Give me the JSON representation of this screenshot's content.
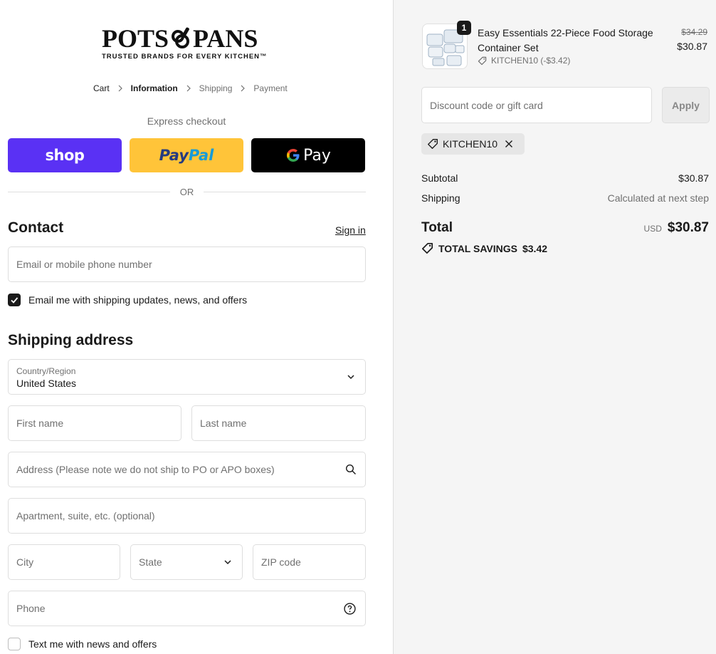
{
  "brand": {
    "logo_text_left": "POTS",
    "logo_text_right": "PANS",
    "tagline": "TRUSTED BRANDS FOR EVERY KITCHEN™"
  },
  "breadcrumb": {
    "items": [
      {
        "label": "Cart",
        "state": "link"
      },
      {
        "label": "Information",
        "state": "current"
      },
      {
        "label": "Shipping",
        "state": "upcoming"
      },
      {
        "label": "Payment",
        "state": "upcoming"
      }
    ]
  },
  "express_checkout": {
    "label": "Express checkout",
    "shop_label": "shop",
    "paypal_pay": "Pay",
    "paypal_pal": "Pal",
    "gpay_label": "Pay",
    "divider": "OR"
  },
  "contact": {
    "title": "Contact",
    "sign_in": "Sign in",
    "email_placeholder": "Email or mobile phone number",
    "newsletter_label": "Email me with shipping updates, news, and offers",
    "newsletter_checked": true
  },
  "shipping": {
    "title": "Shipping address",
    "country_label": "Country/Region",
    "country_value": "United States",
    "first_name_placeholder": "First name",
    "last_name_placeholder": "Last name",
    "address_placeholder": "Address (Please note we do not ship to PO or APO boxes)",
    "apartment_placeholder": "Apartment, suite, etc. (optional)",
    "city_placeholder": "City",
    "state_placeholder": "State",
    "zip_placeholder": "ZIP code",
    "phone_placeholder": "Phone",
    "text_offers_label": "Text me with news and offers",
    "text_offers_checked": false
  },
  "order": {
    "item": {
      "quantity": "1",
      "name": "Easy Essentials 22-Piece Food Storage Container Set",
      "discount_tag": "KITCHEN10 (-$3.42)",
      "original_price": "$34.29",
      "price": "$30.87"
    },
    "discount_placeholder": "Discount code or gift card",
    "apply_label": "Apply",
    "applied_code": "KITCHEN10",
    "subtotal_label": "Subtotal",
    "subtotal_value": "$30.87",
    "shipping_label": "Shipping",
    "shipping_value": "Calculated at next step",
    "total_label": "Total",
    "currency": "USD",
    "total_value": "$30.87",
    "savings_label": "TOTAL SAVINGS",
    "savings_value": "$3.42"
  },
  "colors": {
    "shop_purple": "#5a31f4",
    "paypal_yellow": "#ffc439",
    "gpay_black": "#000000",
    "sidebar_bg": "#f5f5f5"
  }
}
